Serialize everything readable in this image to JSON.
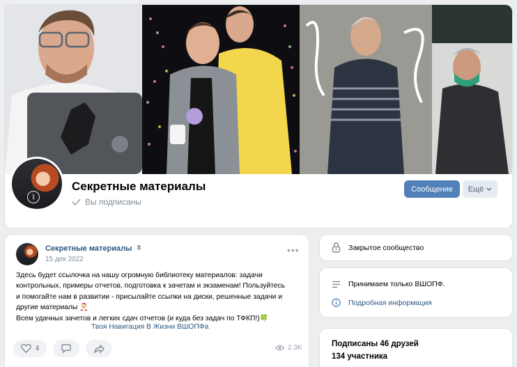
{
  "group": {
    "title": "Секретные материалы",
    "subscribed_label": "Вы подписаны",
    "message_button": "Сообщение",
    "more_button": "Ещё"
  },
  "post": {
    "author": "Секретные материалы",
    "date": "15 дек 2022",
    "text_lines": [
      "Здесь будет ссылочка на нашу огромную библиотеку материалов: задачи",
      "контрольных, примеры отчетов, подготовка к зачетам и экзаменам! Пользуйтесь",
      "и помогайте нам в развитии - присылайте ссылки на диски, решенные задачи и",
      "другие материалы",
      "Всем удачных зачетов и легких сдач отчетов (и куда без задач по ТФКП!)"
    ],
    "emoji_santa": "🎅",
    "emoji_clover": "🍀",
    "link": "Твоя Навигация В Жизни ВШОПФа",
    "likes": "4",
    "views": "2.3K"
  },
  "sidebar": {
    "closed_label": "Закрытое сообщество",
    "accept_label": "Принимаем только ВШОПФ.",
    "details_link": "Подробная информация",
    "friends_subscribed": "Подписаны 46 друзей",
    "members_count": "134 участника"
  },
  "colors": {
    "accent": "#5181b8",
    "link": "#2a5885",
    "background": "#edeef0"
  }
}
